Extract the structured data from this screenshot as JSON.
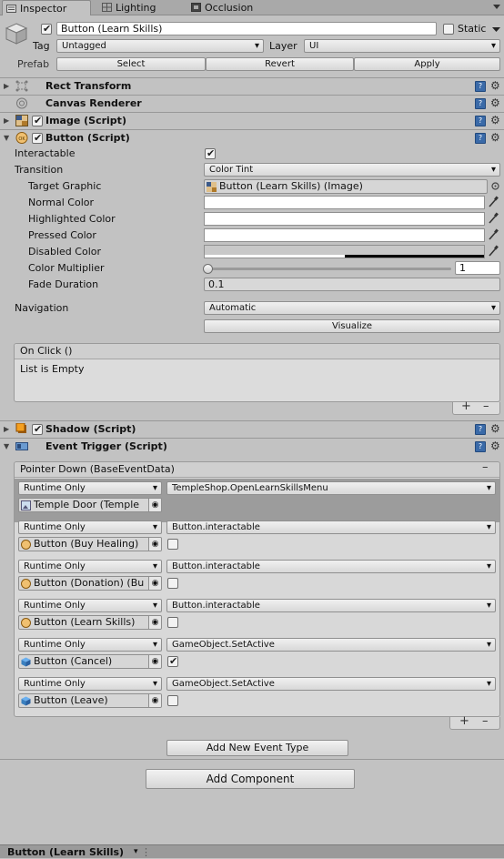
{
  "tabs": [
    {
      "label": "Inspector",
      "icon": "inspector-icon",
      "active": true
    },
    {
      "label": "Lighting",
      "icon": "lighting-icon",
      "active": false
    },
    {
      "label": "Occlusion",
      "icon": "occlusion-icon",
      "active": false
    }
  ],
  "header": {
    "name": "Button (Learn Skills)",
    "static_label": "Static",
    "tag_label": "Tag",
    "tag_value": "Untagged",
    "layer_label": "Layer",
    "layer_value": "UI",
    "prefab_label": "Prefab",
    "select": "Select",
    "revert": "Revert",
    "apply": "Apply"
  },
  "components": {
    "rect_transform": "Rect Transform",
    "canvas_renderer": "Canvas Renderer",
    "image": "Image (Script)",
    "button": "Button (Script)",
    "shadow": "Shadow (Script)",
    "event_trigger": "Event Trigger (Script)"
  },
  "button_props": {
    "interactable": "Interactable",
    "transition": "Transition",
    "transition_value": "Color Tint",
    "target_graphic": "Target Graphic",
    "target_graphic_value": "Button (Learn Skills) (Image)",
    "normal_color": "Normal Color",
    "highlighted_color": "Highlighted Color",
    "pressed_color": "Pressed Color",
    "disabled_color": "Disabled Color",
    "color_multiplier": "Color Multiplier",
    "color_multiplier_value": "1",
    "color_multiplier_fraction": 0.0,
    "fade_duration": "Fade Duration",
    "fade_duration_value": "0.1",
    "navigation": "Navigation",
    "navigation_value": "Automatic",
    "visualize": "Visualize",
    "onclick_title": "On Click ()",
    "onclick_empty": "List is Empty"
  },
  "event_trigger": {
    "title": "Pointer Down (BaseEventData)",
    "entries": [
      {
        "mode": "Runtime Only",
        "function": "TempleShop.OpenLearnSkillsMenu",
        "object": "Temple Door (Temple",
        "has_checkbox": false,
        "checked": false
      },
      {
        "mode": "Runtime Only",
        "function": "Button.interactable",
        "object": "Button (Buy Healing)",
        "has_checkbox": true,
        "checked": false
      },
      {
        "mode": "Runtime Only",
        "function": "Button.interactable",
        "object": "Button (Donation) (Bu",
        "has_checkbox": true,
        "checked": false
      },
      {
        "mode": "Runtime Only",
        "function": "Button.interactable",
        "object": "Button (Learn Skills)",
        "has_checkbox": true,
        "checked": false
      },
      {
        "mode": "Runtime Only",
        "function": "GameObject.SetActive",
        "object": "Button (Cancel)",
        "has_checkbox": true,
        "checked": true
      },
      {
        "mode": "Runtime Only",
        "function": "GameObject.SetActive",
        "object": "Button (Leave)",
        "has_checkbox": true,
        "checked": false
      }
    ],
    "add_new": "Add New Event Type"
  },
  "add_component": "Add Component",
  "footer": {
    "label": "Button (Learn Skills)"
  }
}
